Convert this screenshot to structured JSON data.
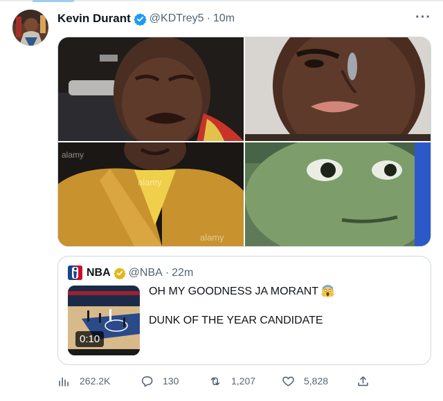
{
  "tweet": {
    "author_name": "Kevin Durant",
    "author_handle": "@KDTrey5",
    "separator": "·",
    "timestamp": "10m",
    "more_label": "···",
    "media": {
      "watermarks": [
        "alamy",
        "alamy",
        "alamy"
      ]
    },
    "quote": {
      "author_name": "NBA",
      "author_handle": "@NBA",
      "separator": "·",
      "timestamp": "22m",
      "text_line1": "OH MY GOODNESS JA MORANT",
      "text_line2": "DUNK OF THE YEAR CANDIDATE",
      "video_duration": "0:10"
    },
    "actions": {
      "views": "262.2K",
      "replies": "130",
      "retweets": "1,207",
      "likes": "5,828"
    }
  },
  "colors": {
    "verified_blue": "#1d9bf0",
    "verified_gold": "#e2b719",
    "muted_text": "#536471",
    "border": "#cfd9de"
  },
  "icons": [
    "views-icon",
    "reply-icon",
    "retweet-icon",
    "like-icon",
    "share-icon",
    "verified-badge-icon",
    "more-options-icon",
    "scream-emoji-icon"
  ]
}
